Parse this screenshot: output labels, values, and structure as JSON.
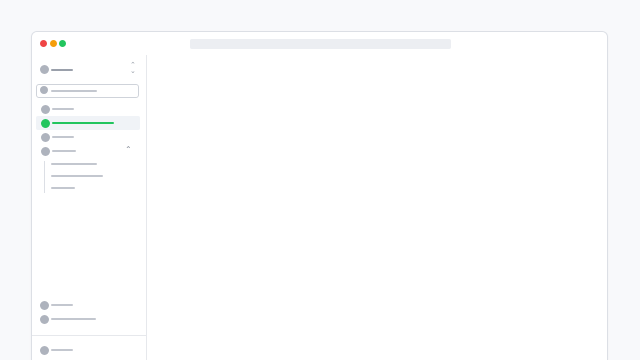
{
  "window": {
    "traffic_lights": {
      "close": "#ef4444",
      "minimize": "#f59e0b",
      "maximize": "#22c55e"
    }
  },
  "sidebar": {
    "workspace_switcher": {
      "icon": "workspace-icon",
      "toggle_icon": "chevron-up-down-icon"
    },
    "search": {
      "icon": "search-icon"
    },
    "nav_items": [
      {
        "icon": "nav-icon",
        "active": false
      },
      {
        "icon": "nav-icon",
        "active": true
      },
      {
        "icon": "nav-icon",
        "active": false
      },
      {
        "icon": "nav-icon",
        "active": false,
        "expanded": true,
        "children": 3
      }
    ],
    "bottom_items": [
      {
        "icon": "nav-icon"
      },
      {
        "icon": "nav-icon"
      }
    ],
    "footer": {
      "icon": "user-icon"
    }
  },
  "colors": {
    "accent": "#22c55e",
    "placeholder": "#c3c7cf",
    "icon": "#aeb3bd",
    "border": "#e6e8ec"
  }
}
